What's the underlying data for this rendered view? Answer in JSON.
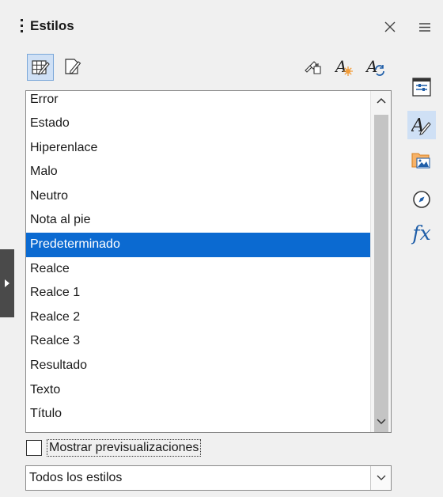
{
  "panel": {
    "title": "Estilos",
    "close_icon": "close-icon",
    "menu_icon": "hamburger-menu-icon"
  },
  "toolbar": {
    "left": [
      {
        "icon": "cell-styles-icon",
        "active": true
      },
      {
        "icon": "page-styles-icon",
        "active": false
      }
    ],
    "right": [
      {
        "icon": "fill-format-mode-icon"
      },
      {
        "icon": "new-style-from-selection-icon"
      },
      {
        "icon": "update-style-icon"
      }
    ]
  },
  "styles": {
    "items": [
      "Error",
      "Estado",
      "Hiperenlace",
      "Malo",
      "Neutro",
      "Nota al pie",
      "Predeterminado",
      "Realce",
      "Realce 1",
      "Realce 2",
      "Realce 3",
      "Resultado",
      "Texto",
      "Título"
    ],
    "selected": "Predeterminado"
  },
  "preview": {
    "label": "Mostrar previsualizaciones",
    "checked": false
  },
  "filter": {
    "value": "Todos los estilos"
  },
  "deck": {
    "tabs": [
      {
        "icon": "properties-icon",
        "active": false
      },
      {
        "icon": "styles-icon",
        "active": true
      },
      {
        "icon": "gallery-icon",
        "active": false
      },
      {
        "icon": "navigator-icon",
        "active": false
      },
      {
        "icon": "functions-icon",
        "label": "fx",
        "active": false
      }
    ]
  },
  "colors": {
    "accent": "#0b6ad1",
    "active_bg": "#cfe0f5",
    "panel_bg": "#f0f0f0",
    "icon_blue": "#1f5ea8",
    "icon_orange": "#f29c38"
  }
}
